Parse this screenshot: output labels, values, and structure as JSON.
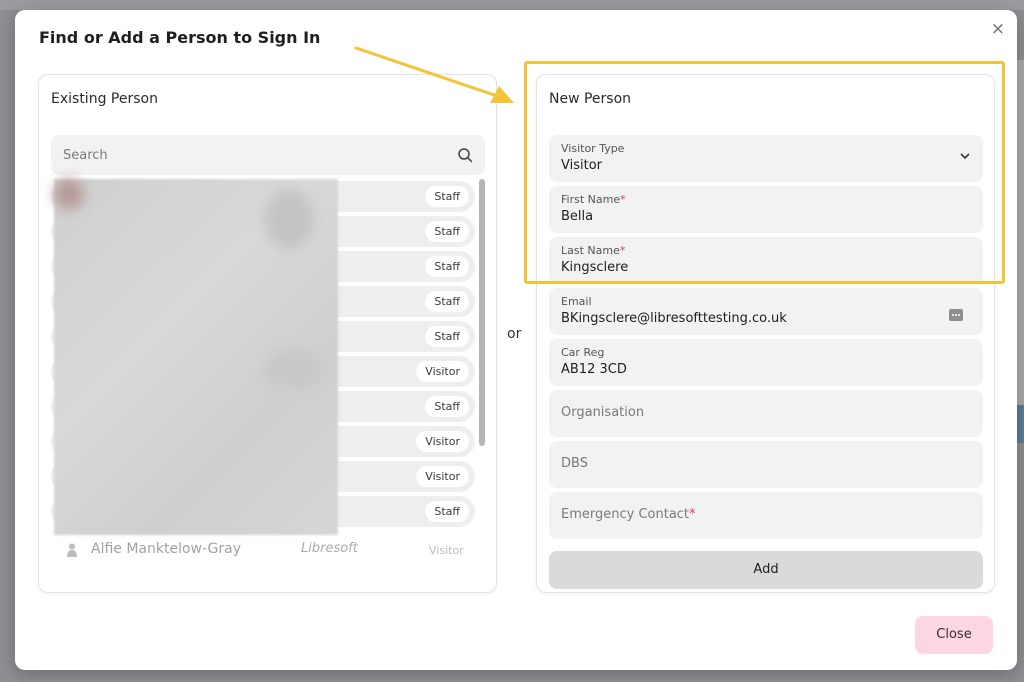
{
  "dialog": {
    "title": "Find or Add a Person to Sign In",
    "close_glyph": "×"
  },
  "existing": {
    "title": "Existing Person",
    "search_placeholder": "Search",
    "rows": [
      {
        "badge": "Staff"
      },
      {
        "badge": "Staff"
      },
      {
        "badge": "Staff"
      },
      {
        "badge": "Staff"
      },
      {
        "badge": "Staff"
      },
      {
        "badge": "Visitor"
      },
      {
        "badge": "Staff"
      },
      {
        "badge": "Visitor"
      },
      {
        "badge": "Visitor"
      },
      {
        "badge": "Staff"
      }
    ],
    "partial_row": {
      "name": "Alfie Manktelow-Gray",
      "organisation": "Libresoft",
      "badge": "Visitor"
    }
  },
  "separator": "or",
  "new_person": {
    "title": "New Person",
    "visitor_type": {
      "label": "Visitor Type",
      "value": "Visitor"
    },
    "first_name": {
      "label": "First Name",
      "required": "*",
      "value": "Bella"
    },
    "last_name": {
      "label": "Last Name",
      "required": "*",
      "value": "Kingsclere"
    },
    "email": {
      "label": "Email",
      "value": "BKingsclere@libresofttesting.co.uk"
    },
    "car_reg": {
      "label": "Car Reg",
      "value": "AB12 3CD"
    },
    "organisation": {
      "placeholder": "Organisation"
    },
    "dbs": {
      "placeholder": "DBS"
    },
    "emergency_contact": {
      "placeholder": "Emergency Contact",
      "required": "*"
    },
    "add_label": "Add"
  },
  "footer": {
    "close_label": "Close"
  },
  "colors": {
    "highlight": "#f3c339",
    "required": "#e03a5c",
    "close_button": "#fdd6e1"
  },
  "icons": [
    "close-icon",
    "search-icon",
    "chevron-down-icon",
    "autofill-icon",
    "person-icon",
    "annotation-arrow"
  ]
}
